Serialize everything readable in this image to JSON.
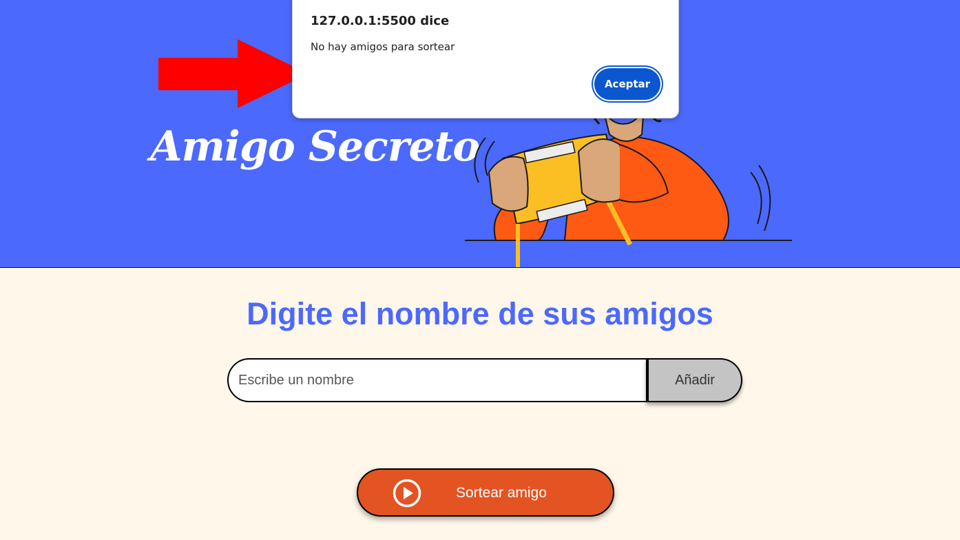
{
  "header": {
    "title": "Amigo Secreto",
    "background_color": "#4b69fd",
    "illustration_icon": "person-holding-box-illustration"
  },
  "annotation": {
    "arrow_icon": "red-arrow-right-icon",
    "arrow_color": "#ff0000"
  },
  "dialog": {
    "title": "127.0.0.1:5500 dice",
    "message": "No hay amigos para sortear",
    "accept_label": "Aceptar",
    "accent_color": "#0b57d0"
  },
  "main": {
    "subtitle": "Digite el nombre de sus amigos",
    "input_placeholder": "Escribe un nombre",
    "input_value": "",
    "add_label": "Añadir",
    "draw_label": "Sortear amigo",
    "draw_icon": "play-circle-icon",
    "draw_color": "#e35422",
    "background_color": "#fff7ea"
  }
}
